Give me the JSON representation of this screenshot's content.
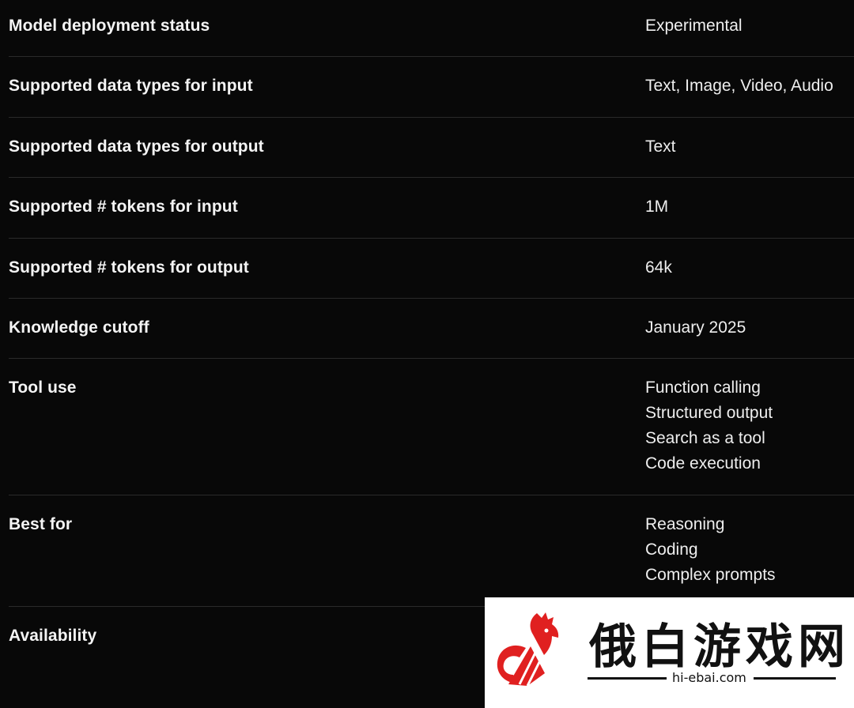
{
  "rows": [
    {
      "label": "Model deployment status",
      "values": [
        "Experimental"
      ]
    },
    {
      "label": "Supported data types for input",
      "values": [
        "Text, Image, Video, Audio"
      ]
    },
    {
      "label": "Supported data types for output",
      "values": [
        "Text"
      ]
    },
    {
      "label": "Supported # tokens for input",
      "values": [
        "1M"
      ]
    },
    {
      "label": "Supported # tokens for output",
      "values": [
        "64k"
      ]
    },
    {
      "label": "Knowledge cutoff",
      "values": [
        "January 2025"
      ]
    },
    {
      "label": "Tool use",
      "values": [
        "Function calling",
        "Structured output",
        "Search as a tool",
        "Code execution"
      ]
    },
    {
      "label": "Best for",
      "values": [
        "Reasoning",
        "Coding",
        "Complex prompts"
      ]
    },
    {
      "label": "Availability",
      "values": []
    }
  ],
  "watermark": {
    "title": "俄白游戏网",
    "url": "hi-ebai.com",
    "logo_icon": "rooster-logo-icon",
    "logo_color": "#e02020"
  }
}
